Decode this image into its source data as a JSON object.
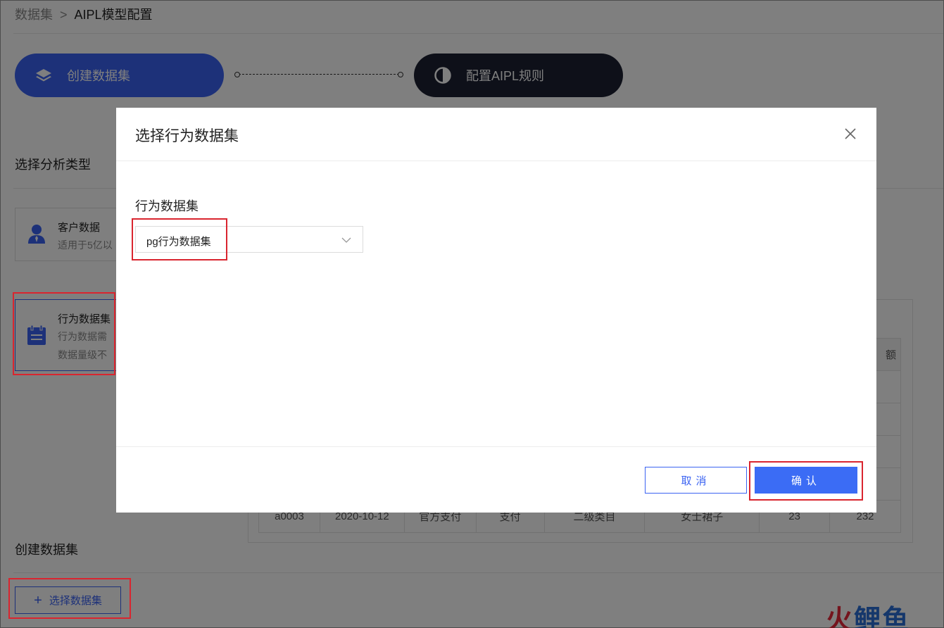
{
  "breadcrumb": {
    "root": "数据集",
    "separator": ">",
    "current": "AIPL模型配置"
  },
  "steps": [
    {
      "label": "创建数据集",
      "icon": "layers-icon"
    },
    {
      "label": "配置AIPL规则",
      "icon": "half-circle-icon"
    }
  ],
  "colors": {
    "primary": "#3b63f2",
    "dark_step": "#1c2133",
    "highlight": "#d9252f"
  },
  "analysis_section": {
    "title": "选择分析类型"
  },
  "type_cards": [
    {
      "title": "客户数据",
      "desc_lines": [
        "适用于5亿以"
      ],
      "icon": "user-icon"
    },
    {
      "title": "行为数据集",
      "desc_lines": [
        "行为数据需",
        "数据量级不"
      ],
      "icon": "clipboard-icon"
    }
  ],
  "table": {
    "header_tail": "额",
    "row": [
      "a0003",
      "2020-10-12",
      "官方支付",
      "支付",
      "二级类目",
      "女士裙子",
      "23",
      "232"
    ]
  },
  "create_section": {
    "title": "创建数据集",
    "select_button": "选择数据集"
  },
  "modal": {
    "title": "选择行为数据集",
    "field_label": "行为数据集",
    "select_value": "pg行为数据集",
    "cancel_label": "取消",
    "confirm_label": "确认"
  },
  "watermark": {
    "part1": "火",
    "part2": "鲤鱼"
  }
}
